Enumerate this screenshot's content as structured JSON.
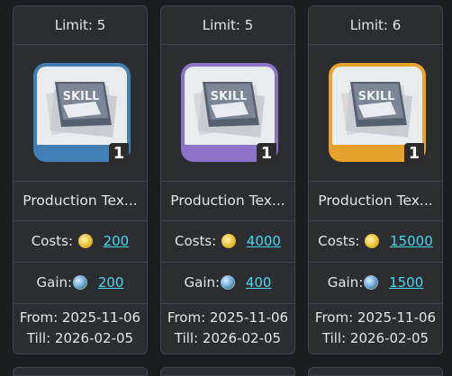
{
  "cards": [
    {
      "limit": "Limit: 5",
      "name": "Production Tex...",
      "costs_label": "Costs:",
      "cost": "200",
      "gain_label": "Gain:",
      "gain": "200",
      "from": "From: 2025-11-06",
      "till": "Till: 2026-02-05",
      "badge": "1",
      "book_label": "SKILL",
      "tier_color": "#4b9fd2"
    },
    {
      "limit": "Limit: 5",
      "name": "Production Tex...",
      "costs_label": "Costs:",
      "cost": "4000",
      "gain_label": "Gain:",
      "gain": "400",
      "from": "From: 2025-11-06",
      "till": "Till: 2026-02-05",
      "badge": "1",
      "book_label": "SKILL",
      "tier_color": "#9a83d8"
    },
    {
      "limit": "Limit: 6",
      "name": "Production Tex...",
      "costs_label": "Costs:",
      "cost": "15000",
      "gain_label": "Gain:",
      "gain": "1500",
      "from": "From: 2025-11-06",
      "till": "Till: 2026-02-05",
      "badge": "1",
      "book_label": "SKILL",
      "tier_color": "#f0a92a"
    }
  ],
  "icons": {
    "cost": "gold-coin-icon",
    "gain": "globe-icon"
  },
  "colors": {
    "background": "#1b1d21",
    "card": "#2b2d31",
    "border": "#41444a",
    "link": "#4ad8ee"
  }
}
